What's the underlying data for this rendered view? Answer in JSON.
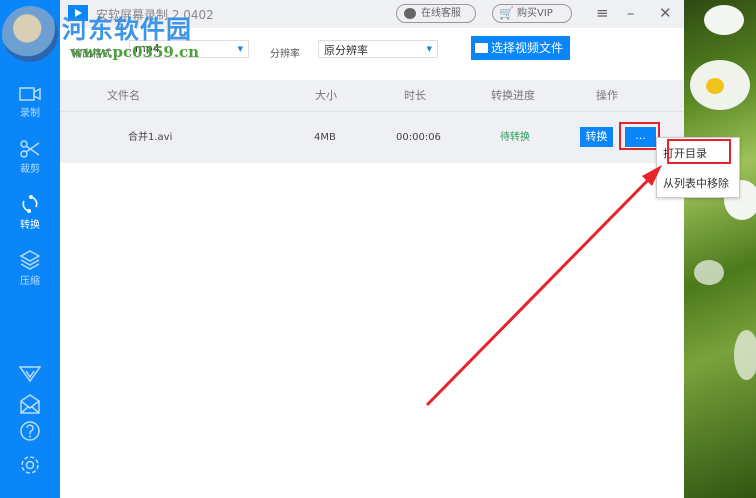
{
  "window": {
    "title": "安软屏幕录制 2.0402",
    "service_label": "在线客服",
    "vip_label": "购买VIP"
  },
  "sidebar": {
    "items": [
      {
        "label": "录制"
      },
      {
        "label": "裁剪"
      },
      {
        "label": "转换"
      },
      {
        "label": "压缩"
      }
    ]
  },
  "toolbar": {
    "format_label": "输出格式",
    "format_value": "mp4",
    "resolution_label": "分辨率",
    "resolution_value": "原分辨率",
    "pick_label": "选择视频文件"
  },
  "table": {
    "headers": [
      "文件名",
      "大小",
      "时长",
      "转换进度",
      "操作"
    ],
    "rows": [
      {
        "name": "合并1.avi",
        "size": "4MB",
        "duration": "00:00:06",
        "status": "待转换",
        "convert_label": "转换",
        "more_label": "..."
      }
    ]
  },
  "context_menu": {
    "items": [
      "打开目录",
      "从列表中移除"
    ]
  },
  "watermark": {
    "name": "河东软件园",
    "url": "www.pc0359.cn"
  },
  "colors": {
    "accent": "#0a86f8",
    "status": "#2e9b5a",
    "highlight": "#e8232a"
  }
}
